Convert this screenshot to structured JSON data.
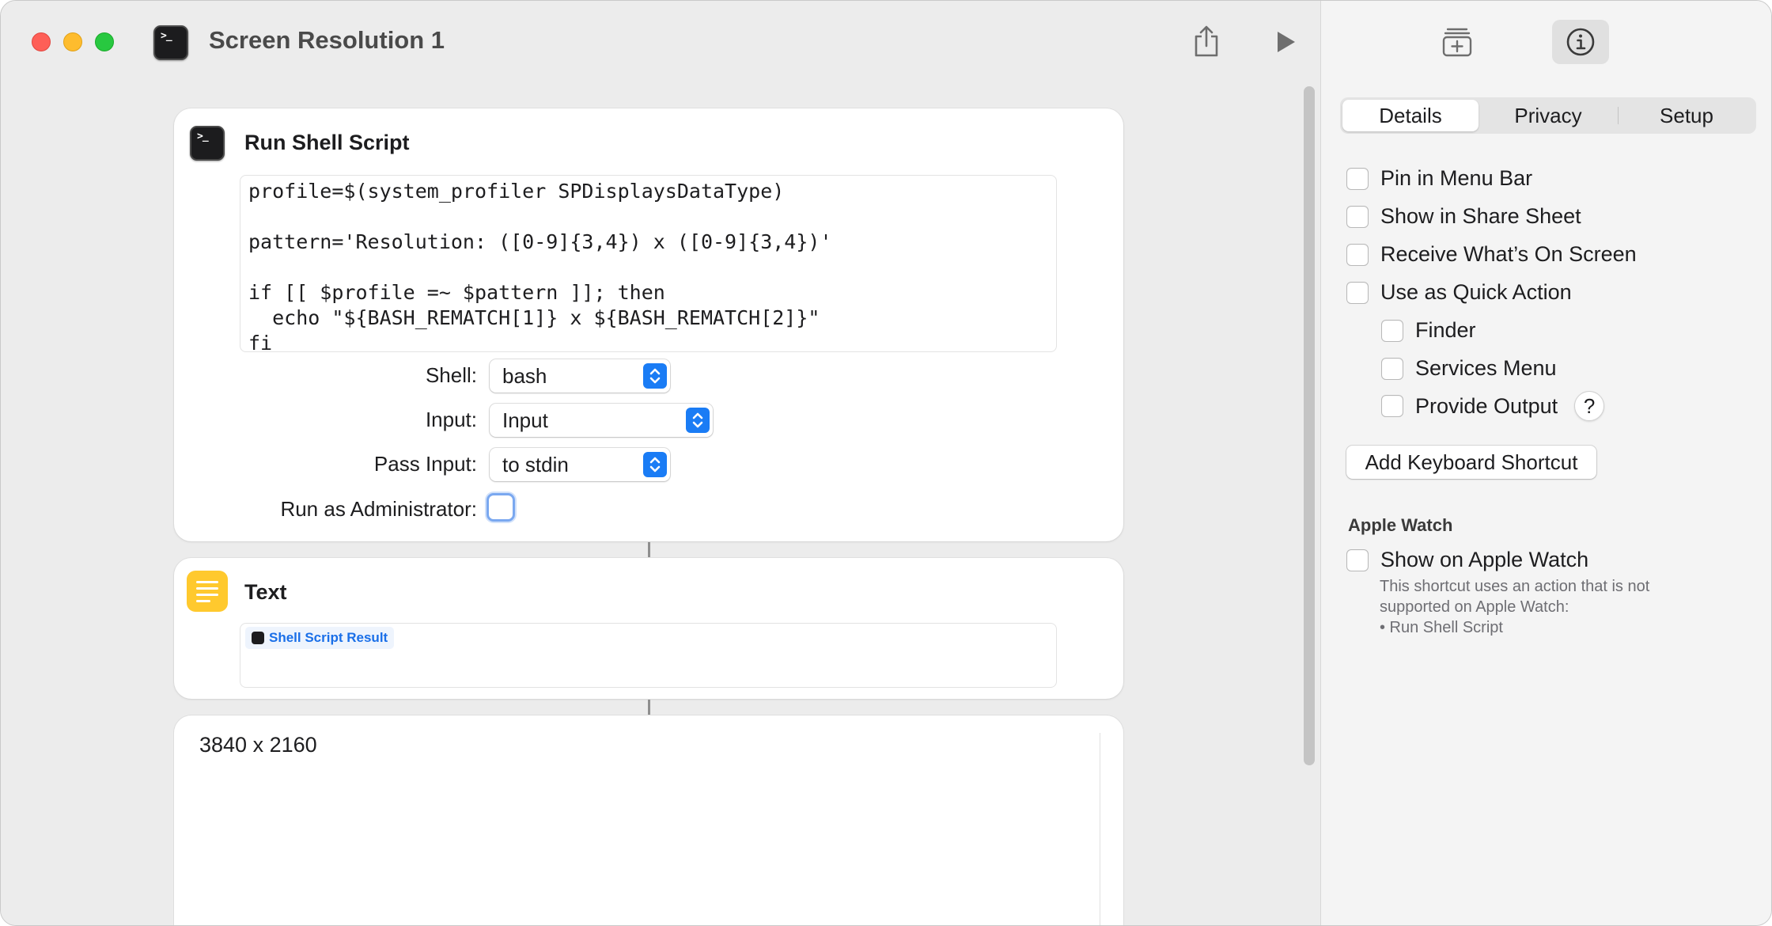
{
  "window": {
    "title": "Screen Resolution 1"
  },
  "toolbar": {
    "share_icon": "share-icon",
    "run_icon": "play-icon"
  },
  "actions": [
    {
      "title": "Run Shell Script",
      "icon": "terminal-icon",
      "script_lines": [
        "profile=$(system_profiler SPDisplaysDataType)",
        "",
        "pattern='Resolution: ([0-9]{3,4}) x ([0-9]{3,4})'",
        "",
        "if [[ $profile =~ $pattern ]]; then",
        "  echo \"${BASH_REMATCH[1]} x ${BASH_REMATCH[2]}\"",
        "fi"
      ],
      "params": {
        "shell_label": "Shell:",
        "shell_value": "bash",
        "input_label": "Input:",
        "input_value": "Input",
        "pass_input_label": "Pass Input:",
        "pass_input_value": "to stdin",
        "admin_label": "Run as Administrator:",
        "admin_checked": false
      }
    },
    {
      "title": "Text",
      "icon": "text-lines-icon",
      "token_label": "Shell Script Result"
    }
  ],
  "result": {
    "text": "3840 x 2160"
  },
  "sidebar": {
    "top_icons": [
      "add-to-library-icon",
      "info-icon"
    ],
    "tabs": [
      "Details",
      "Privacy",
      "Setup"
    ],
    "active_tab": "Details",
    "options": [
      {
        "label": "Pin in Menu Bar",
        "checked": false
      },
      {
        "label": "Show in Share Sheet",
        "checked": false
      },
      {
        "label": "Receive What’s On Screen",
        "checked": false
      },
      {
        "label": "Use as Quick Action",
        "checked": false
      }
    ],
    "sub_options": [
      {
        "label": "Finder",
        "checked": false
      },
      {
        "label": "Services Menu",
        "checked": false
      },
      {
        "label": "Provide Output",
        "checked": false
      }
    ],
    "help_label": "?",
    "keyboard_button": "Add Keyboard Shortcut",
    "apple_watch": {
      "heading": "Apple Watch",
      "option": "Show on Apple Watch",
      "note_lines": [
        "This shortcut uses an action that is not",
        "supported on Apple Watch:",
        "• Run Shell Script"
      ]
    }
  },
  "colors": {
    "accent": "#1a7cf5",
    "text_action": "#ffc92e",
    "token_text": "#1a6fe8"
  }
}
